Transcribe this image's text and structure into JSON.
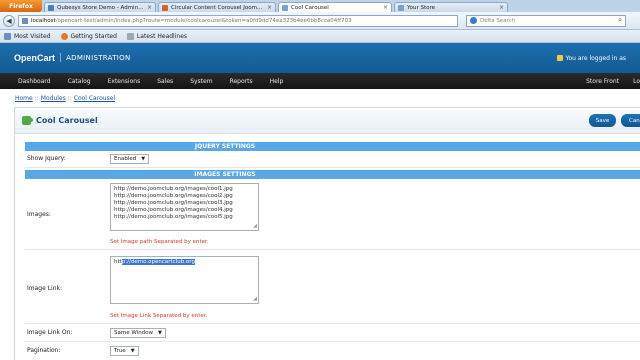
{
  "browser": {
    "menu_button": "Firefox",
    "tabs": [
      {
        "label": "Qubesys Store Demo - Administratio...",
        "color": "#4d7cc0"
      },
      {
        "label": "Circular Content Corousel Joomla M...",
        "color": "#d2642a"
      },
      {
        "label": "Cool Carousel",
        "color": "#7aa0cf",
        "active": true
      },
      {
        "label": "Your Store",
        "color": "#7aa0cf"
      }
    ],
    "url_host": "localhost",
    "url_rest": "/opencart-test/admin/index.php?route=module/coolcarousel&token=a0fd9dd74ea323b4ee6bb8cca04ff703",
    "search_placeholder": "Delta Search",
    "bookmarks": [
      "Most Visited",
      "Getting Started",
      "Latest Headlines"
    ]
  },
  "header": {
    "logo": "OpenCart",
    "separator": "|",
    "admin_label": "ADMINISTRATION",
    "user_status": "You are logged in as"
  },
  "menu": {
    "items": [
      "Dashboard",
      "Catalog",
      "Extensions",
      "Sales",
      "System",
      "Reports",
      "Help"
    ],
    "right_items": [
      "Store Front",
      "Lo"
    ]
  },
  "breadcrumb": [
    "Home",
    "Modules",
    "Cool Carousel"
  ],
  "breadcrumb_separator": "::",
  "page": {
    "title": "Cool Carousel",
    "save_label": "Save",
    "cancel_label": "Canc"
  },
  "form": {
    "jquery_section": "JQUERY SETTINGS",
    "images_section": "IMAGES SETTINGS",
    "show_jquery": {
      "label": "Show Jquery:",
      "value": "Enabled"
    },
    "images": {
      "label": "Images:",
      "lines": [
        "http://demo.joomclub.org/images/cool1.jpg",
        "http://demo.joomclub.org/images/cool2.jpg",
        "http://demo.joomclub.org/images/cool3.jpg",
        "http://demo.joomclub.org/images/cool4.jpg",
        "http://demo.joomclub.org/images/cool5.jpg"
      ],
      "hint": "Set Image path Separated by enter."
    },
    "image_link": {
      "label": "Image Link:",
      "value_start": "htt",
      "value_selected": "p://demo.opencartclub.org",
      "hint": "Set Image Link Separated by enter."
    },
    "image_link_on": {
      "label": "Image Link On:",
      "value": "Same Window"
    },
    "pagination": {
      "label": "Pagination:",
      "value": "True"
    }
  }
}
